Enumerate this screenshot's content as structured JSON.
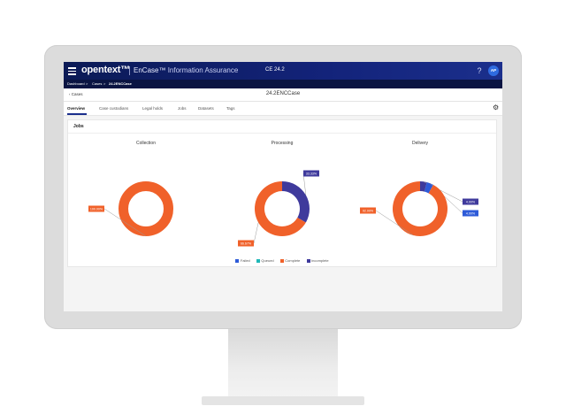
{
  "header": {
    "brand": "opentext™",
    "product_main": "EnCase™",
    "product_sub": "Information Assurance",
    "version": "CE 24.2",
    "help_label": "?",
    "avatar_initials": "AP"
  },
  "breadcrumb": {
    "items": [
      "Dashboard",
      "Cases",
      "24.2ENCCase"
    ],
    "separator": ">"
  },
  "case": {
    "back_label": "‹ Cases",
    "title": "24.2ENCCase"
  },
  "tabs": [
    {
      "label": "Overview",
      "active": true
    },
    {
      "label": "Case custodians",
      "active": false
    },
    {
      "label": "Legal holds",
      "active": false
    },
    {
      "label": "Jobs",
      "active": false
    },
    {
      "label": "Datasets",
      "active": false
    },
    {
      "label": "Tags",
      "active": false
    }
  ],
  "card": {
    "title": "Jobs"
  },
  "colors": {
    "failed": "#2e5bd8",
    "queued": "#1fb7b7",
    "complete": "#f0612a",
    "incomplete": "#3f3a9c"
  },
  "chart_data": [
    {
      "type": "pie",
      "title": "Collection",
      "slices": [
        {
          "name": "Complete",
          "value": 100.0,
          "label": "100.00%"
        }
      ]
    },
    {
      "type": "pie",
      "title": "Processing",
      "slices": [
        {
          "name": "Incomplete",
          "value": 33.33,
          "label": "33.33%"
        },
        {
          "name": "Complete",
          "value": 66.67,
          "label": "66.67%"
        }
      ]
    },
    {
      "type": "pie",
      "title": "Delivery",
      "slices": [
        {
          "name": "Incomplete",
          "value": 4.0,
          "label": "4.00%"
        },
        {
          "name": "Failed",
          "value": 4.0,
          "label": "4.00%"
        },
        {
          "name": "Complete",
          "value": 92.0,
          "label": "92.00%"
        }
      ]
    }
  ],
  "legend": {
    "placement": "bottom",
    "items": [
      "Failed",
      "Queued",
      "Complete",
      "Incomplete"
    ]
  }
}
